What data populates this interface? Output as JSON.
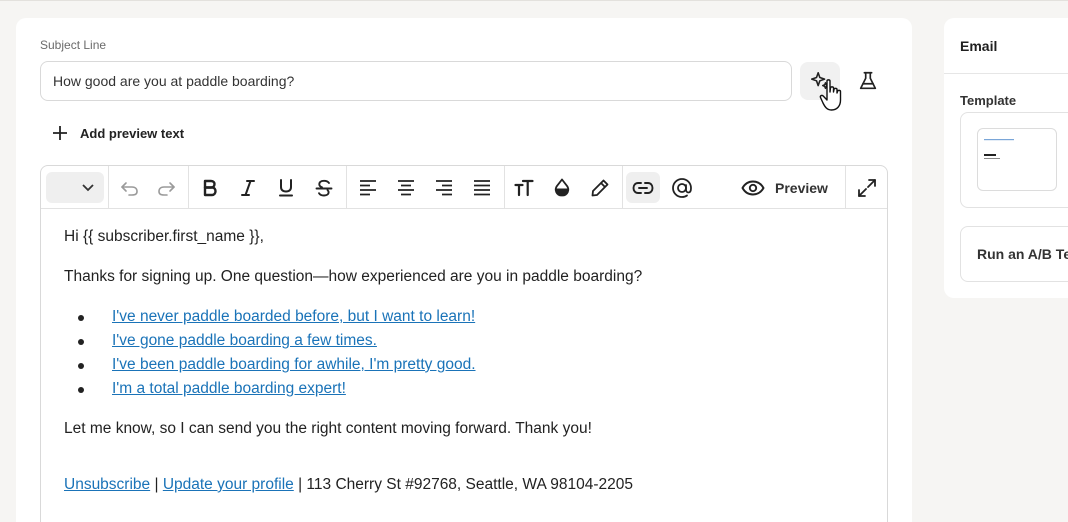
{
  "subject": {
    "label": "Subject Line",
    "value": "How good are you at paddle boarding?"
  },
  "add_preview_label": "Add preview text",
  "toolbar": {
    "preview_label": "Preview"
  },
  "email_body": {
    "greeting": "Hi {{ subscriber.first_name }},",
    "intro": "Thanks for signing up. One question—how experienced are you in paddle boarding?",
    "options": [
      "I've never paddle boarded before, but I want to learn!",
      "I've gone paddle boarding a few times.",
      "I've been paddle boarding for awhile, I'm pretty good.",
      "I'm a total paddle boarding expert!"
    ],
    "closing": "Let me know, so I can send you the right content moving forward. Thank you!",
    "footer": {
      "unsubscribe": "Unsubscribe",
      "separator": "|",
      "update_profile": "Update your profile",
      "address": "| 113 Cherry St #92768, Seattle, WA 98104-2205"
    }
  },
  "sidebar": {
    "title": "Email",
    "template_label": "Template",
    "ab_test_label": "Run an A/B Te"
  },
  "colors": {
    "link": "#1a73b8",
    "background": "#f6f5f3"
  }
}
